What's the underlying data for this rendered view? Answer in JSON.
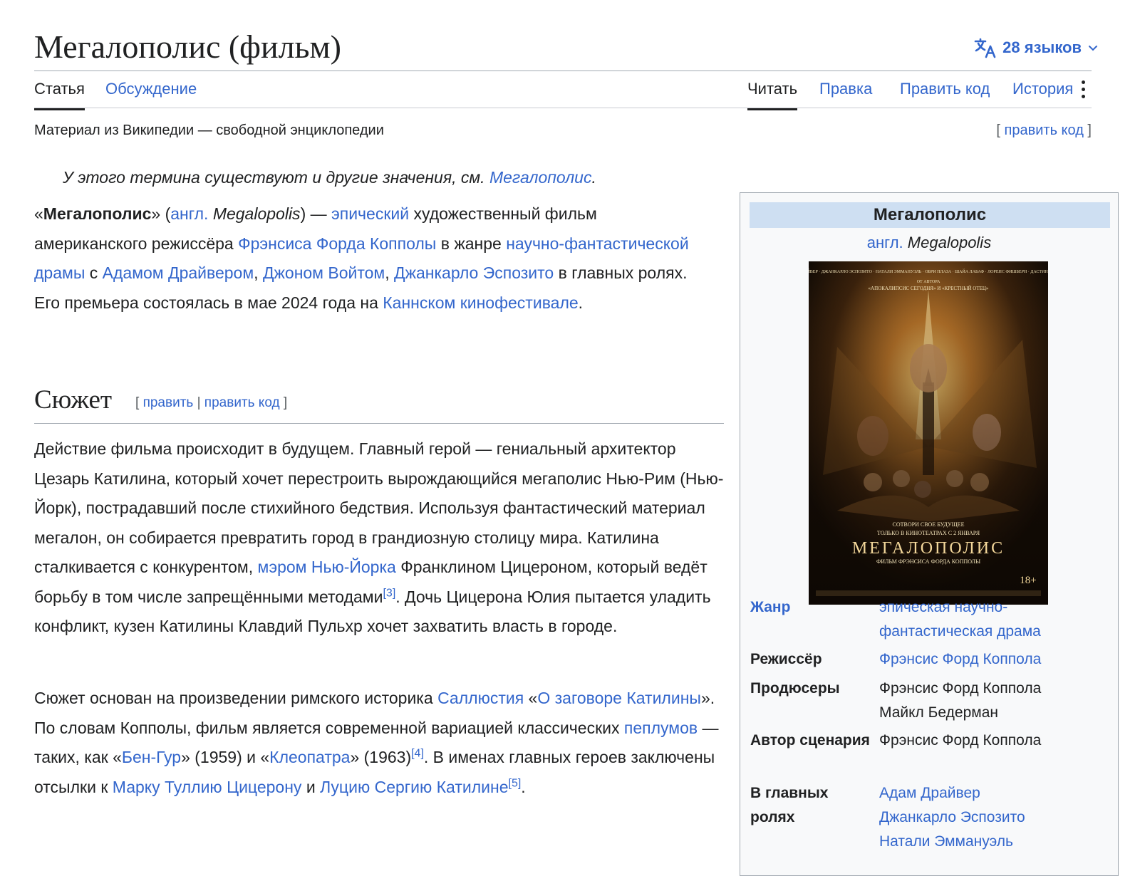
{
  "header": {
    "title": "Мегалополис (фильм)",
    "languages_label": "28 языков"
  },
  "tabs": {
    "article": "Статья",
    "talk": "Обсуждение",
    "read": "Читать",
    "edit": "Правка",
    "edit_source": "Править код",
    "history": "История"
  },
  "tagline": "Материал из Википедии — свободной энциклопедии",
  "top_edit": {
    "open": "[ ",
    "label": "править код",
    "close": " ]"
  },
  "hatnote": {
    "text": "У этого термина существуют и другие значения, см. ",
    "link": "Мегалополис",
    "end": "."
  },
  "intro": {
    "q_open": "«",
    "bold": "Мегалополис",
    "q_close": "» (",
    "lang": "англ.",
    "sp1": " ",
    "orig": "Megalopolis",
    "t1": ") — ",
    "l_epic": "эпический",
    "t2": " художественный фильм американского режиссёра ",
    "l_coppola": "Фрэнсиса Форда Копполы",
    "t3": " в жанре ",
    "l_genre": "научно-фантастической драмы",
    "t4": " с ",
    "l_driver": "Адамом Драйвером",
    "t5": ", ",
    "l_voight": "Джоном Войтом",
    "t6": ", ",
    "l_esposito": "Джанкарло Эспозито",
    "t7": " в главных ролях. Его премьера состоялась в мае 2024 года на ",
    "l_cannes": "Каннском кинофестивале",
    "t8": "."
  },
  "plot": {
    "heading": "Сюжет",
    "edit_open": "[ ",
    "edit": "править",
    "sep": " | ",
    "edit_source": "править код",
    "edit_close": " ]",
    "p1": {
      "t1": "Действие фильма происходит в будущем. Главный герой — гениальный архитектор Цезарь Катилина, который хочет перестроить вырождающийся мегаполис Нью-Рим (Нью-Йорк), пострадавший после стихийного бедствия. Используя фантастический материал мегалон, он собирается превратить город в грандиозную столицу мира. Катилина сталкивается с конкурентом, ",
      "l_mayor": "мэром Нью-Йорка",
      "t2": " Франклином Цицероном, который ведёт борьбу в том числе запрещёнными методами",
      "ref3": "[3]",
      "t3": ". Дочь Цицерона Юлия пытается уладить конфликт, кузен Катилины Клавдий Пульхр хочет захватить власть в городе."
    },
    "p2": {
      "t1": "Сюжет основан на произведении римского историка ",
      "l_sallust": "Саллюстия",
      "t2": " «",
      "l_conspiracy": "О заговоре Катилины",
      "t3": "». По словам Копполы, фильм является современной вариацией классических ",
      "l_peplum": "пеплумов",
      "t4": " — таких, как «",
      "l_benhur": "Бен-Гур",
      "t5": "» (1959) и «",
      "l_cleopatra": "Клеопатра",
      "t6": "» (1963)",
      "ref4": "[4]",
      "t7": ". В именах главных героев заключены отсылки к ",
      "l_cicero": "Марку Туллию Цицерону",
      "t8": " и ",
      "l_catiline": "Луцию Сергию Катилине",
      "ref5": "[5]",
      "t9": "."
    }
  },
  "infobox": {
    "title": "Мегалополис",
    "lang": "англ.",
    "orig": "Megalopolis",
    "poster": {
      "cast_top": "АДАМ ДРАЙВЕР · ДЖАНКАРЛО ЭСПОЗИТО · НАТАЛИ ЭММАНУЭЛЬ · ОБРИ ПЛАЗА · ШАЙА ЛАБАФ · ЛОРЕНС ФИШБЕРН · ДАСТИН ХОФФМАН",
      "from": "ОТ АВТОРА",
      "from_works": "«АПОКАЛИПСИС СЕГОДНЯ» И «КРЕСТНЫЙ ОТЕЦ»",
      "slogan": "СОТВОРИ СВОЕ БУДУЩЕЕ",
      "release": "ТОЛЬКО В КИНОТЕАТРАХ С 2 ЯНВАРЯ",
      "title": "МЕГАЛОПОЛИС",
      "subtitle": "ФИЛЬМ ФРЭНСИСА ФОРДА КОППОЛЫ",
      "age": "18+"
    },
    "rows": [
      {
        "label": "Жанр",
        "value": "эпическая научно-фантастическая драма"
      },
      {
        "label": "Режиссёр",
        "value": "Фрэнсис Форд Коппола"
      },
      {
        "label": "Продюсеры",
        "value1": "Фрэнсис Форд Коппола",
        "value2": "Майкл Бедерман"
      },
      {
        "label": "Автор сценария",
        "value": "Фрэнсис Форд Коппола"
      },
      {
        "label": "В главных ролях",
        "value1": "Адам Драйвер",
        "value2": "Джанкарло Эспозито",
        "value3": "Натали Эммануэль"
      }
    ]
  },
  "colors": {
    "link": "#3366cc",
    "text": "#202122",
    "infobox_header": "#cedff2",
    "infobox_bg": "#f8f9fa"
  }
}
